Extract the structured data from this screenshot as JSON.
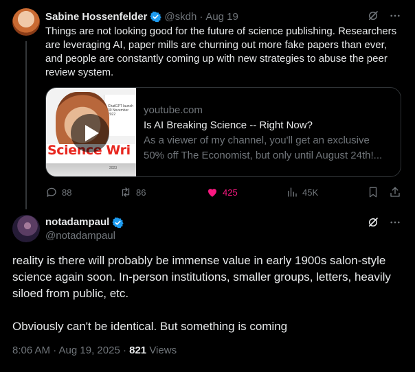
{
  "colors": {
    "background": "#000000",
    "text": "#e7e9ea",
    "muted": "#71767b",
    "like": "#f91880",
    "verified": "#1d9bf0"
  },
  "parent_tweet": {
    "author_name": "Sabine Hossenfelder",
    "handle": "@skdh",
    "separator": "·",
    "date": "Aug 19",
    "text": "Things are not looking good for the future of science publishing. Researchers are leveraging AI, paper mills are churning out more fake papers than ever, and people are constantly coming up with new strategies to abuse the peer review system.",
    "card": {
      "domain": "youtube.com",
      "title": "Is AI Breaking Science -- Right Now?",
      "description_line1": "As a viewer of my channel, you'll get an exclusive",
      "description_line2": "50% off The Economist, but only until August 24th!...",
      "thumbnail_text": "Science Wri",
      "thumbnail_screen_text": "ChatGPT launch 30 November 2022",
      "thumbnail_year": "2023"
    },
    "stats": {
      "replies": "88",
      "reposts": "86",
      "likes": "425",
      "views": "45K"
    },
    "icons": [
      "grok-icon",
      "more-icon",
      "reply-icon",
      "repost-icon",
      "heart-icon",
      "views-icon",
      "bookmark-icon",
      "share-icon"
    ]
  },
  "main_tweet": {
    "author_name": "notadampaul",
    "handle": "@notadampaul",
    "paragraph1": "reality is there will probably be immense value in early 1900s salon-style science again soon. In-person institutions, smaller groups, letters, heavily siloed from public, etc.",
    "paragraph2": "Obviously can't be identical. But something is coming",
    "timestamp": "8:06 AM · Aug 19, 2025 ·",
    "views_count": "821",
    "views_label": "Views"
  }
}
